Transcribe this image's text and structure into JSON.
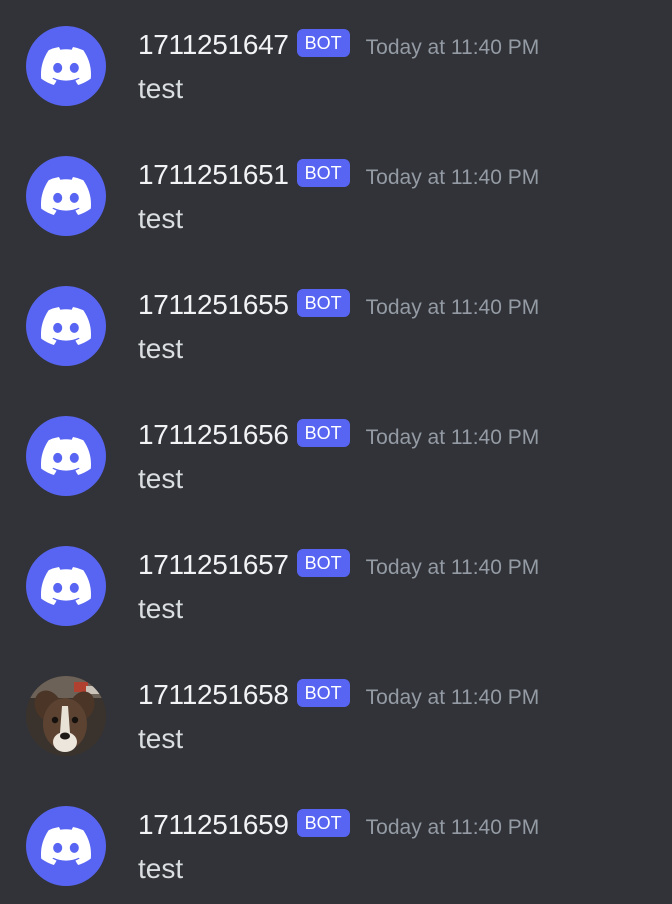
{
  "colors": {
    "background": "#313338",
    "blurple": "#5865F2",
    "username": "#f2f3f5",
    "timestamp": "#949ba4",
    "content": "#dbdee1"
  },
  "messages": [
    {
      "username": "1711251647",
      "tag": "BOT",
      "timestamp": "Today at 11:40 PM",
      "content": "test",
      "avatar": "discord-logo-icon"
    },
    {
      "username": "1711251651",
      "tag": "BOT",
      "timestamp": "Today at 11:40 PM",
      "content": "test",
      "avatar": "discord-logo-icon"
    },
    {
      "username": "1711251655",
      "tag": "BOT",
      "timestamp": "Today at 11:40 PM",
      "content": "test",
      "avatar": "discord-logo-icon"
    },
    {
      "username": "1711251656",
      "tag": "BOT",
      "timestamp": "Today at 11:40 PM",
      "content": "test",
      "avatar": "discord-logo-icon"
    },
    {
      "username": "1711251657",
      "tag": "BOT",
      "timestamp": "Today at 11:40 PM",
      "content": "test",
      "avatar": "discord-logo-icon"
    },
    {
      "username": "1711251658",
      "tag": "BOT",
      "timestamp": "Today at 11:40 PM",
      "content": "test",
      "avatar": "dog-photo"
    },
    {
      "username": "1711251659",
      "tag": "BOT",
      "timestamp": "Today at 11:40 PM",
      "content": "test",
      "avatar": "discord-logo-icon"
    }
  ]
}
